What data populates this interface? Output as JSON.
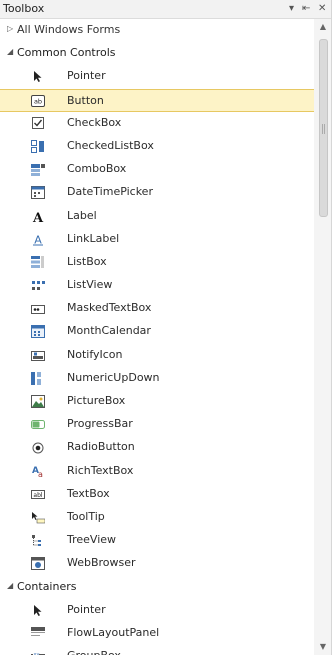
{
  "window": {
    "title": "Toolbox",
    "pin_glyph": "▾",
    "autohide_glyph": "⇤",
    "close_glyph": "✕"
  },
  "categories": [
    {
      "label": "All Windows Forms",
      "expanded": false
    },
    {
      "label": "Common Controls",
      "expanded": true
    },
    {
      "label": "Containers",
      "expanded": true
    }
  ],
  "common_controls": [
    {
      "label": "Pointer",
      "icon": "pointer-icon"
    },
    {
      "label": "Button",
      "icon": "button-icon",
      "selected": true
    },
    {
      "label": "CheckBox",
      "icon": "checkbox-icon"
    },
    {
      "label": "CheckedListBox",
      "icon": "checkedlistbox-icon"
    },
    {
      "label": "ComboBox",
      "icon": "combobox-icon"
    },
    {
      "label": "DateTimePicker",
      "icon": "datetimepicker-icon"
    },
    {
      "label": "Label",
      "icon": "label-icon"
    },
    {
      "label": "LinkLabel",
      "icon": "linklabel-icon"
    },
    {
      "label": "ListBox",
      "icon": "listbox-icon"
    },
    {
      "label": "ListView",
      "icon": "listview-icon"
    },
    {
      "label": "MaskedTextBox",
      "icon": "maskedtextbox-icon"
    },
    {
      "label": "MonthCalendar",
      "icon": "monthcalendar-icon"
    },
    {
      "label": "NotifyIcon",
      "icon": "notifyicon-icon"
    },
    {
      "label": "NumericUpDown",
      "icon": "numericupdown-icon"
    },
    {
      "label": "PictureBox",
      "icon": "picturebox-icon"
    },
    {
      "label": "ProgressBar",
      "icon": "progressbar-icon"
    },
    {
      "label": "RadioButton",
      "icon": "radiobutton-icon"
    },
    {
      "label": "RichTextBox",
      "icon": "richtextbox-icon"
    },
    {
      "label": "TextBox",
      "icon": "textbox-icon"
    },
    {
      "label": "ToolTip",
      "icon": "tooltip-icon"
    },
    {
      "label": "TreeView",
      "icon": "treeview-icon"
    },
    {
      "label": "WebBrowser",
      "icon": "webbrowser-icon"
    }
  ],
  "containers": [
    {
      "label": "Pointer",
      "icon": "pointer-icon"
    },
    {
      "label": "FlowLayoutPanel",
      "icon": "flowlayoutpanel-icon"
    },
    {
      "label": "GroupBox",
      "icon": "groupbox-icon"
    }
  ],
  "colors": {
    "selection_bg": "#fdf3c7",
    "selection_border": "#e7c862",
    "icon_blue": "#3a6fb0",
    "icon_gray": "#555555"
  }
}
